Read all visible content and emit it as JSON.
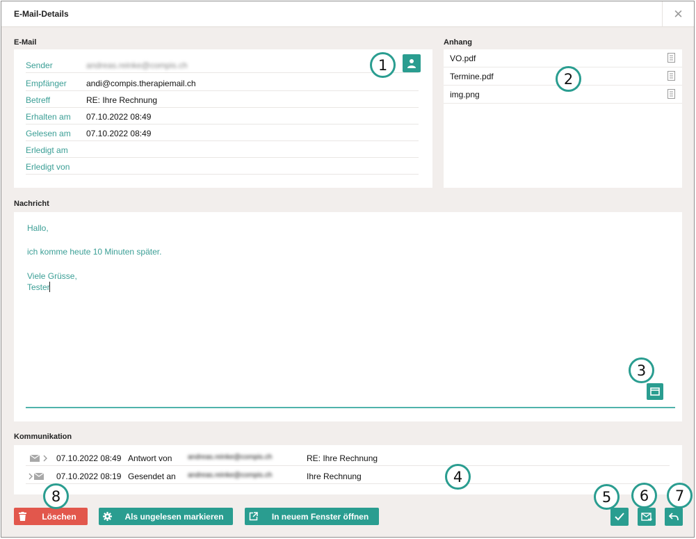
{
  "dialog": {
    "title": "E-Mail-Details",
    "close_symbol": "✕"
  },
  "email": {
    "section_label": "E-Mail",
    "fields": [
      {
        "label": "Sender",
        "value": "andreas.reinke@compis.ch"
      },
      {
        "label": "Empfänger",
        "value": "andi@compis.therapiemail.ch"
      },
      {
        "label": "Betreff",
        "value": "RE: Ihre Rechnung"
      },
      {
        "label": "Erhalten am",
        "value": "07.10.2022 08:49"
      },
      {
        "label": "Gelesen am",
        "value": "07.10.2022 08:49"
      },
      {
        "label": "Erledigt am",
        "value": ""
      },
      {
        "label": "Erledigt von",
        "value": ""
      }
    ],
    "contact_icon": "person-icon"
  },
  "attachments": {
    "section_label": "Anhang",
    "items": [
      {
        "name": "VO.pdf"
      },
      {
        "name": "Termine.pdf"
      },
      {
        "name": "img.png"
      }
    ],
    "item_icon": "document-icon"
  },
  "message": {
    "section_label": "Nachricht",
    "lines": [
      "Hallo,",
      "ich komme heute 10 Minuten später.",
      "Viele Grüsse,",
      "Tester"
    ],
    "expand_icon": "window-icon"
  },
  "communication": {
    "section_label": "Kommunikation",
    "rows": [
      {
        "datetime": "07.10.2022 08:49",
        "direction": "Antwort von",
        "address": "andreas.reinke@compis.ch",
        "subject": "RE: Ihre Rechnung"
      },
      {
        "datetime": "07.10.2022 08:19",
        "direction": "Gesendet an",
        "address": "andreas.reinke@compis.ch",
        "subject": "Ihre Rechnung"
      }
    ]
  },
  "actions": {
    "delete_label": "Löschen",
    "mark_unread_label": "Als ungelesen markieren",
    "open_window_label": "In neuem Fenster öffnen"
  },
  "callouts": [
    "1",
    "2",
    "3",
    "4",
    "5",
    "6",
    "7",
    "8"
  ],
  "colors": {
    "accent": "#2a9d90",
    "danger": "#e2574c",
    "text_accent": "#3a9e95"
  }
}
